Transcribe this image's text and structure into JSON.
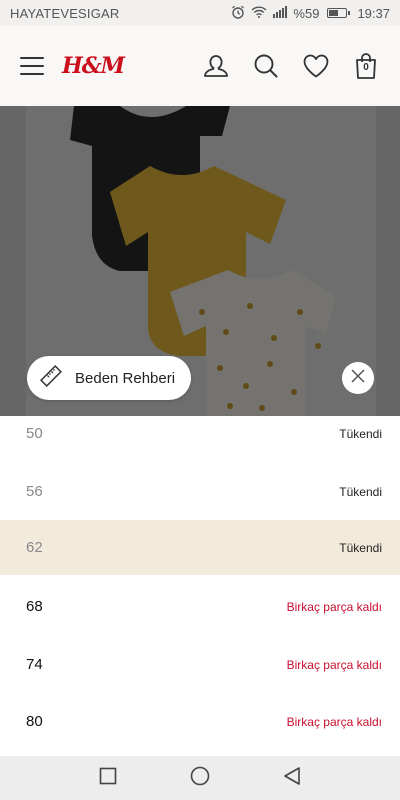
{
  "status_bar": {
    "carrier": "HAYATEVESIGAR",
    "battery": "%59",
    "battery_level": 0.59,
    "time": "19:37"
  },
  "header": {
    "logo": "H&M",
    "bag_count": "0"
  },
  "size_guide": {
    "label": "Beden Rehberi"
  },
  "sizes": [
    {
      "size": "50",
      "status": "Tükendi"
    },
    {
      "size": "56",
      "status": "Tükendi"
    },
    {
      "size": "62",
      "status": "Tükendi"
    },
    {
      "size": "68",
      "status": "Birkaç parça kaldı"
    },
    {
      "size": "74",
      "status": "Birkaç parça kaldı"
    },
    {
      "size": "80",
      "status": "Birkaç parça kaldı"
    }
  ],
  "colors": {
    "brand_red": "#cc0f1d",
    "low_stock_red": "#c8102e",
    "selected_row": "#f2ebdc"
  }
}
